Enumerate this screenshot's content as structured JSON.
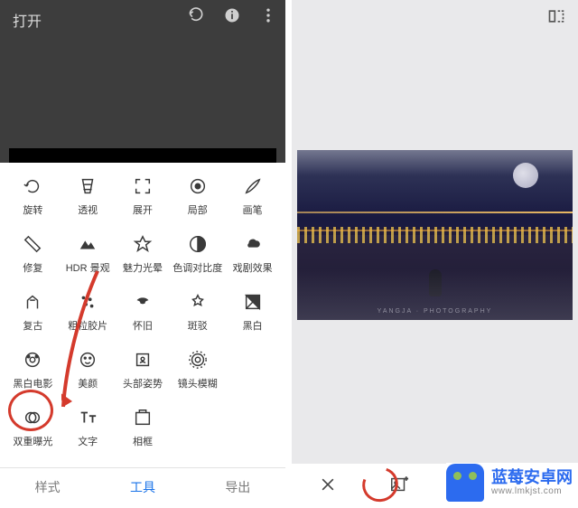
{
  "left": {
    "title": "打开",
    "tools": [
      [
        {
          "name": "rotate",
          "label": "旋转"
        },
        {
          "name": "perspective",
          "label": "透视"
        },
        {
          "name": "expand",
          "label": "展开"
        },
        {
          "name": "selective",
          "label": "局部"
        },
        {
          "name": "brush",
          "label": "画笔"
        }
      ],
      [
        {
          "name": "healing",
          "label": "修复"
        },
        {
          "name": "hdr",
          "label": "HDR 景观"
        },
        {
          "name": "glamour",
          "label": "魅力光晕"
        },
        {
          "name": "tonal",
          "label": "色调对比度"
        },
        {
          "name": "drama",
          "label": "戏剧效果"
        }
      ],
      [
        {
          "name": "vintage",
          "label": "复古"
        },
        {
          "name": "grainy",
          "label": "粗粒胶片"
        },
        {
          "name": "retrolux",
          "label": "怀旧"
        },
        {
          "name": "grunge",
          "label": "斑驳"
        },
        {
          "name": "bw",
          "label": "黑白"
        }
      ],
      [
        {
          "name": "noir",
          "label": "黑白电影"
        },
        {
          "name": "portrait",
          "label": "美颜"
        },
        {
          "name": "headpose",
          "label": "头部姿势"
        },
        {
          "name": "lensblur",
          "label": "镜头模糊"
        },
        {
          "name": "",
          "label": ""
        }
      ],
      [
        {
          "name": "double-exposure",
          "label": "双重曝光"
        },
        {
          "name": "text",
          "label": "文字"
        },
        {
          "name": "frame",
          "label": "相框"
        },
        {
          "name": "",
          "label": ""
        },
        {
          "name": "",
          "label": ""
        }
      ]
    ],
    "tabs": {
      "styles": "样式",
      "tools": "工具",
      "export": "导出",
      "active": "tools"
    }
  },
  "right": {
    "watermark_text": "YANGJA · PHOTOGRAPHY"
  },
  "badge": {
    "title": "蓝莓安卓网",
    "url": "www.lmkjst.com"
  }
}
